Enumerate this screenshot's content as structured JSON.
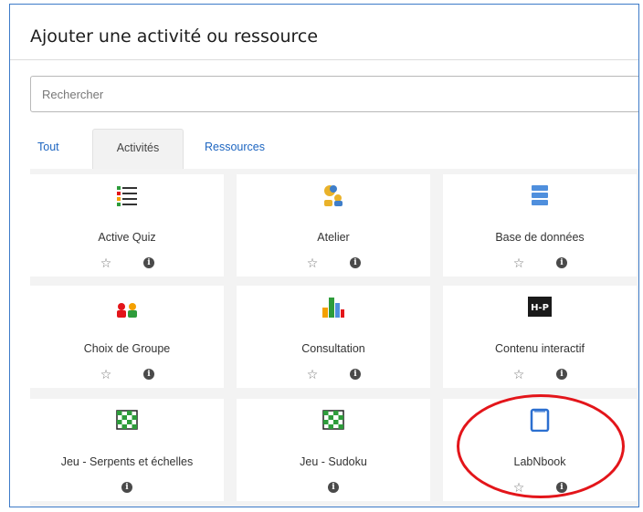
{
  "dialog": {
    "title": "Ajouter une activité ou ressource"
  },
  "search": {
    "placeholder": "Rechercher"
  },
  "tabs": [
    {
      "label": "Tout",
      "active": false
    },
    {
      "label": "Activités",
      "active": true
    },
    {
      "label": "Ressources",
      "active": false
    }
  ],
  "cards": [
    {
      "name": "Active Quiz",
      "icon": "list-icon",
      "starred": false
    },
    {
      "name": "Atelier",
      "icon": "workshop-icon",
      "starred": false
    },
    {
      "name": "Base de données",
      "icon": "database-icon",
      "starred": false
    },
    {
      "name": "Choix de Groupe",
      "icon": "group-choice-icon",
      "starred": false
    },
    {
      "name": "Consultation",
      "icon": "bar-chart-icon",
      "starred": false
    },
    {
      "name": "Contenu interactif",
      "icon": "h5p-icon",
      "starred": false
    },
    {
      "name": "Jeu - Serpents et échelles",
      "icon": "snakes-ladders-board-icon",
      "starred": null
    },
    {
      "name": "Jeu - Sudoku",
      "icon": "sudoku-board-icon",
      "starred": null
    },
    {
      "name": "LabNbook",
      "icon": "notebook-icon",
      "starred": false
    }
  ],
  "icons": {
    "star": "☆",
    "info": "i"
  },
  "colors": {
    "accent": "#1e66c1",
    "highlight_circle": "#e3151a",
    "frame_border": "#3d7ac8"
  }
}
